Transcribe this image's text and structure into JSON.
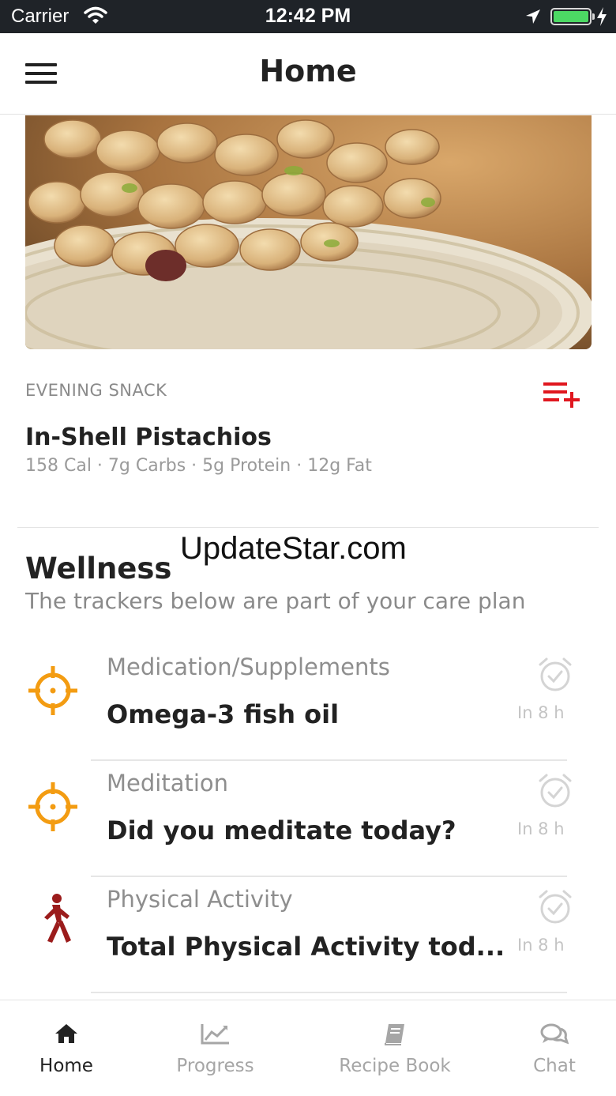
{
  "status_bar": {
    "carrier": "Carrier",
    "time": "12:42 PM"
  },
  "nav": {
    "title": "Home"
  },
  "meal": {
    "label": "EVENING SNACK",
    "name": "In-Shell Pistachios",
    "macros": "158 Cal · 7g Carbs · 5g Protein · 12g Fat"
  },
  "watermark": "UpdateStar.com",
  "wellness": {
    "title": "Wellness",
    "subtitle": "The trackers below are part of your care plan",
    "trackers": [
      {
        "category": "Medication/Supplements",
        "name": "Omega-3 fish oil",
        "due": "In 8 h",
        "icon": "target-icon",
        "color": "#f39c12"
      },
      {
        "category": "Meditation",
        "name": "Did you meditate today?",
        "due": "In 8 h",
        "icon": "target-icon",
        "color": "#f39c12"
      },
      {
        "category": "Physical Activity",
        "name": "Total Physical Activity tod...",
        "due": "In 8 h",
        "icon": "walking-person-icon",
        "color": "#9b1c1c"
      }
    ]
  },
  "tabs": [
    {
      "label": "Home",
      "icon": "home-icon",
      "active": true
    },
    {
      "label": "Progress",
      "icon": "chart-icon",
      "active": false
    },
    {
      "label": "Recipe Book",
      "icon": "book-icon",
      "active": false
    },
    {
      "label": "Chat",
      "icon": "chat-icon",
      "active": false
    }
  ],
  "colors": {
    "accent_red": "#e0171f",
    "tracker_orange": "#f39c12",
    "activity_red": "#9b1c1c",
    "battery_green": "#4cd964"
  }
}
